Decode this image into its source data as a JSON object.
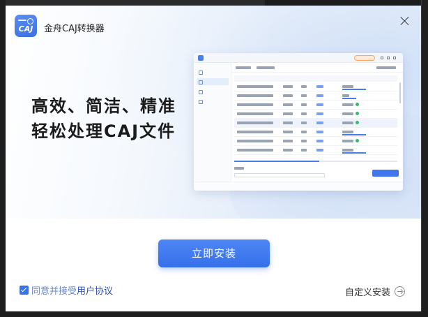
{
  "window": {
    "title": "金舟CAJ转换器",
    "logo_text": "CAJ"
  },
  "hero": {
    "headline_line1": "高效、简洁、精准",
    "headline_line2": "轻松处理CAJ文件"
  },
  "actions": {
    "install_label": "立即安装",
    "custom_install_label": "自定义安装"
  },
  "agreement": {
    "checked": true,
    "prefix": "同意并接受",
    "link": "用户协议"
  },
  "colors": {
    "accent": "#3a72e8",
    "link": "#2d54b8"
  },
  "icons": {
    "close": "close-icon",
    "checkbox": "checkbox-checked-icon",
    "custom_install": "arrow-right-circle-icon"
  }
}
